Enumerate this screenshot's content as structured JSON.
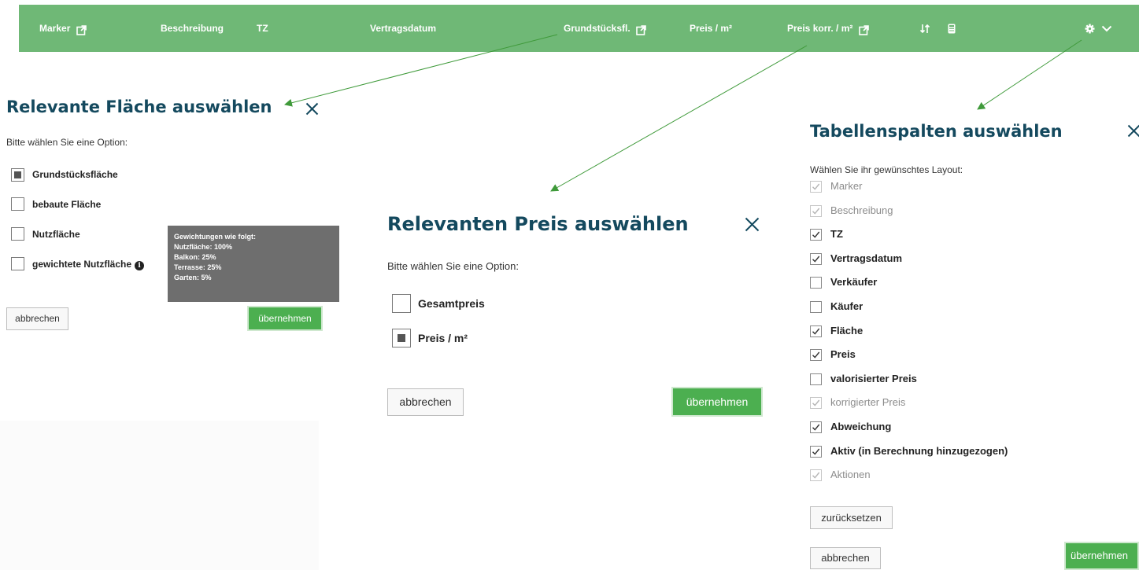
{
  "header": {
    "marker": "Marker",
    "beschreibung": "Beschreibung",
    "tz": "TZ",
    "vertragsdatum": "Vertragsdatum",
    "grundstuecksfl": "Grundstücksfl.",
    "preis_m2": "Preis / m²",
    "preis_korr": "Preis korr. / m²",
    "sort_icon": "sort-icon",
    "calculator_icon": "calculator-icon",
    "settings_icon": "gear-icon",
    "chevron_icon": "chevron-down-icon",
    "bg_color": "#6fb876"
  },
  "flaeche": {
    "title": "Relevante Fläche auswählen",
    "prompt": "Bitte wählen Sie eine Option:",
    "options": [
      {
        "label": "Grundstücksfläche",
        "selected": true
      },
      {
        "label": "bebaute Fläche",
        "selected": false
      },
      {
        "label": "Nutzfläche",
        "selected": false
      },
      {
        "label": "gewichtete Nutzfläche",
        "selected": false
      }
    ],
    "tooltip": [
      "Gewichtungen wie folgt:",
      "Nutzfläche: 100%",
      "Balkon: 25%",
      "Terrasse: 25%",
      "Garten: 5%"
    ],
    "cancel": "abbrechen",
    "apply": "übernehmen"
  },
  "preis": {
    "title": "Relevanten Preis auswählen",
    "prompt": "Bitte wählen Sie eine Option:",
    "options": [
      {
        "label": "Gesamtpreis",
        "selected": false
      },
      {
        "label": "Preis / m²",
        "selected": true
      }
    ],
    "cancel": "abbrechen",
    "apply": "übernehmen"
  },
  "spalten": {
    "title": "Tabellenspalten auswählen",
    "prompt": "Wählen Sie ihr gewünschtes Layout:",
    "columns": [
      {
        "label": "Marker",
        "checked": true,
        "disabled": true
      },
      {
        "label": "Beschreibung",
        "checked": true,
        "disabled": true
      },
      {
        "label": "TZ",
        "checked": true,
        "disabled": false
      },
      {
        "label": "Vertragsdatum",
        "checked": true,
        "disabled": false
      },
      {
        "label": "Verkäufer",
        "checked": false,
        "disabled": false
      },
      {
        "label": "Käufer",
        "checked": false,
        "disabled": false
      },
      {
        "label": "Fläche",
        "checked": true,
        "disabled": false
      },
      {
        "label": "Preis",
        "checked": true,
        "disabled": false
      },
      {
        "label": "valorisierter Preis",
        "checked": false,
        "disabled": false
      },
      {
        "label": "korrigierter Preis",
        "checked": true,
        "disabled": true
      },
      {
        "label": "Abweichung",
        "checked": true,
        "disabled": false
      },
      {
        "label": "Aktiv (in Berechnung hinzugezogen)",
        "checked": true,
        "disabled": false
      },
      {
        "label": "Aktionen",
        "checked": true,
        "disabled": true
      }
    ],
    "reset": "zurücksetzen",
    "cancel": "abbrechen",
    "apply": "übernehmen"
  },
  "colors": {
    "accent_green": "#4caf50",
    "title_blue": "#14495e",
    "tooltip_gray": "#6e6e6e"
  }
}
